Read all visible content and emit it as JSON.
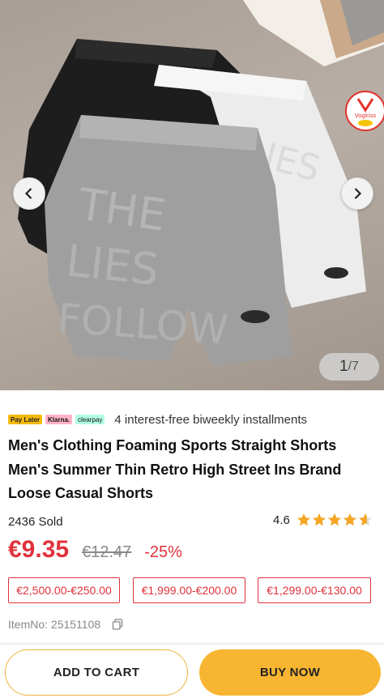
{
  "gallery": {
    "current": "1",
    "total": "/7",
    "badge_text": "Vogkiss"
  },
  "installments": {
    "logos": [
      "Pay Later",
      "Klarna.",
      "clearpay"
    ],
    "text": "4 interest-free biweekly installments"
  },
  "product": {
    "title": "Men's Clothing Foaming Sports Straight Shorts Men's Summer Thin Retro High Street Ins Brand Loose Casual Shorts",
    "sold": "2436 Sold",
    "rating": "4.6",
    "rating_value": 4.6,
    "rating_max": 5,
    "price": "€9.35",
    "original_price": "€12.47",
    "discount": "-25%",
    "item_no": "ItemNo: 25151108"
  },
  "coupons": [
    "€2,500.00-€250.00",
    "€1,999.00-€200.00",
    "€1,299.00-€130.00"
  ],
  "actions": {
    "add_to_cart": "ADD TO CART",
    "buy_now": "BUY NOW"
  },
  "colors": {
    "price_red": "#e0323c",
    "buy_yellow": "#f7b531",
    "star_gold": "#f5a623"
  }
}
